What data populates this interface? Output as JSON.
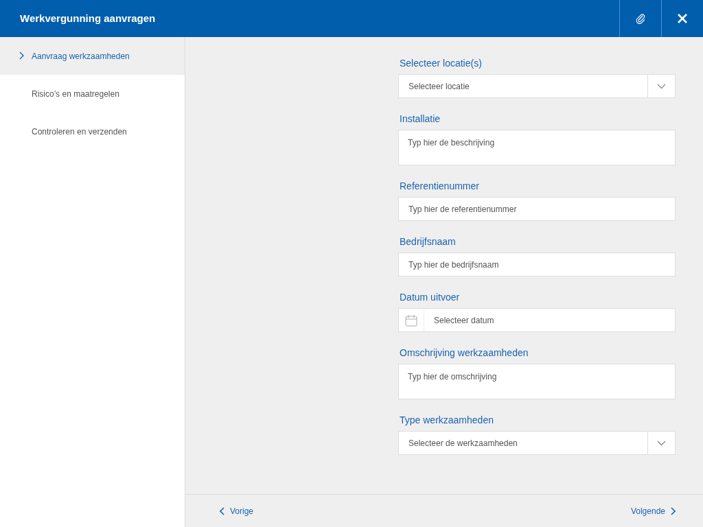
{
  "window": {
    "title": "Werkvergunning aanvragen"
  },
  "sidebar": {
    "items": [
      {
        "label": "Aanvraag werkzaamheden",
        "selected": true
      },
      {
        "label": "Risico’s en maatregelen",
        "selected": false
      },
      {
        "label": "Controleren en verzenden",
        "selected": false
      }
    ]
  },
  "form": {
    "fields": [
      {
        "kind": "select",
        "label": "Selecteer locatie(s)",
        "placeholder": "Selecteer locatie"
      },
      {
        "kind": "textarea",
        "label": "Installatie",
        "placeholder": "Typ hier de beschrijving"
      },
      {
        "kind": "text",
        "label": "Referentienummer",
        "placeholder": "Typ hier de referentienummer"
      },
      {
        "kind": "text",
        "label": "Bedrijfsnaam",
        "placeholder": "Typ hier de bedrijfsnaam"
      },
      {
        "kind": "date",
        "label": "Datum uitvoer",
        "placeholder": "Selecteer datum"
      },
      {
        "kind": "textarea",
        "label": "Omschrijving werkzaamheden",
        "placeholder": "Typ hier de omschrijving"
      },
      {
        "kind": "select",
        "label": "Type werkzaamheden",
        "placeholder": "Selecteer de werkzaamheden"
      }
    ]
  },
  "footer": {
    "previous": "Vorige",
    "next": "Volgende"
  }
}
